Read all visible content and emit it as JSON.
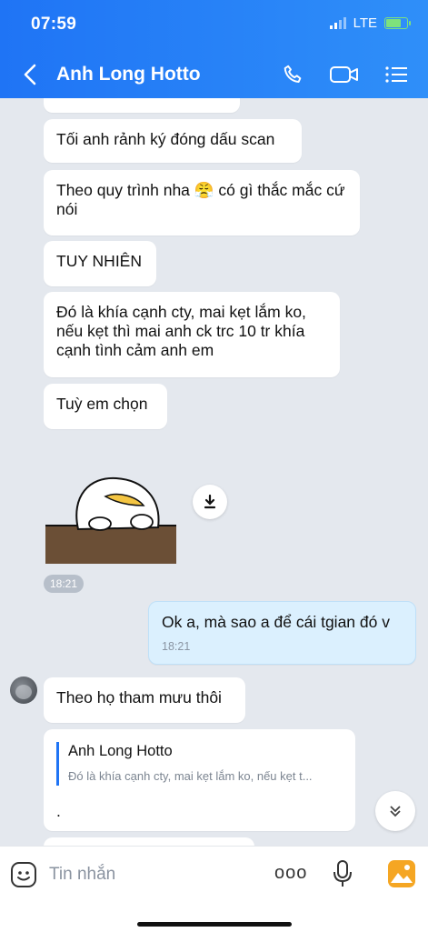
{
  "status_bar": {
    "time": "07:59",
    "network": "LTE",
    "battery_level": 0.75
  },
  "header": {
    "title": "Anh Long Hotto",
    "icons": [
      "back-icon",
      "phone-icon",
      "video-icon",
      "menu-icon"
    ]
  },
  "messages": [
    {
      "text": "Tối anh rảnh ký đóng dấu scan"
    },
    {
      "text": "Theo quy trình nha 😤 có gì thắc mắc cứ nói"
    },
    {
      "text": "TUY NHIÊN"
    },
    {
      "text": "Đó là khía cạnh cty, mai kẹt lắm ko, nếu kẹt thì mai anh ck trc 10 tr khía cạnh tình cảm anh em"
    },
    {
      "text": "Tuỳ em chọn"
    }
  ],
  "sticker": {
    "time": "18:21"
  },
  "sent": {
    "text": "Ok a, mà sao a để cái tgian đó v",
    "time": "18:21"
  },
  "reply": {
    "text": "Theo họ tham mưu thôi",
    "quote_name": "Anh Long Hotto",
    "quote_text": "Đó là khía cạnh cty, mai kẹt lắm ko, nếu kẹt t...",
    "body": "."
  },
  "input": {
    "placeholder": "Tin nhắn",
    "more_label": "ooo"
  },
  "colors": {
    "header": "#1f74f5",
    "background": "#e4e8ee",
    "sent_bubble": "#dbf0fe"
  }
}
